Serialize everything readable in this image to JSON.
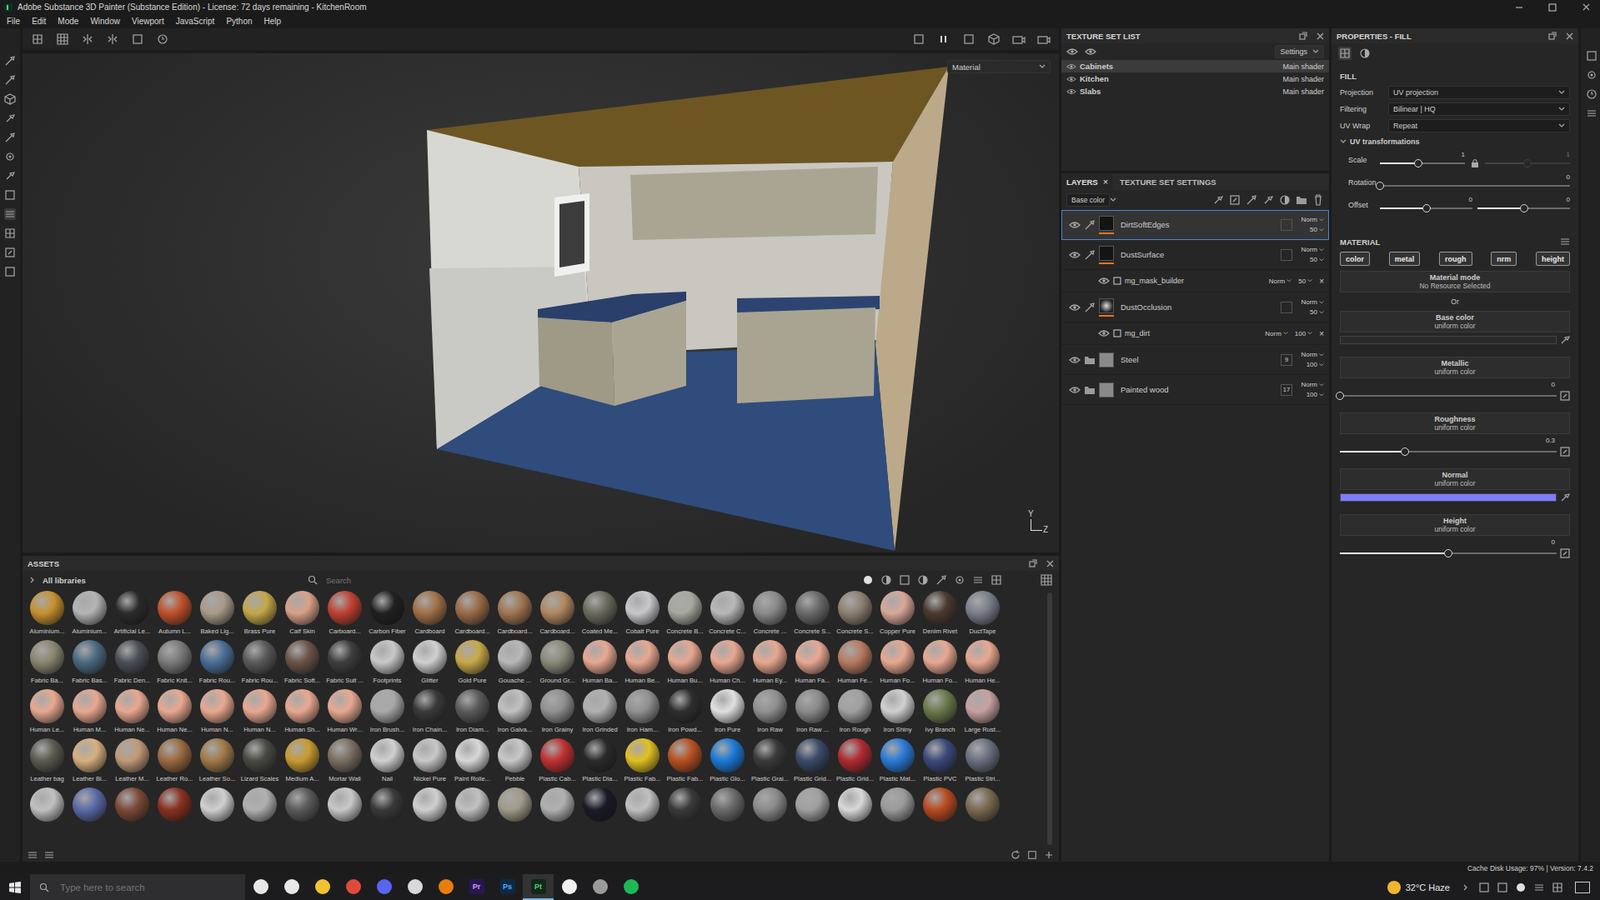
{
  "window": {
    "title": "Adobe Substance 3D Painter (Substance Edition) - License: 72 days remaining - KitchenRoom"
  },
  "menu": [
    "File",
    "Edit",
    "Mode",
    "Window",
    "Viewport",
    "JavaScript",
    "Python",
    "Help"
  ],
  "viewport": {
    "shading": "Material",
    "axes": [
      "Y",
      "Z"
    ]
  },
  "texture_set_list": {
    "title": "TEXTURE SET LIST",
    "settings": "Settings",
    "items": [
      {
        "name": "Cabinets",
        "shader": "Main shader",
        "selected": true,
        "visible": true
      },
      {
        "name": "Kitchen",
        "shader": "Main shader",
        "selected": false,
        "visible": true
      },
      {
        "name": "Slabs",
        "shader": "Main shader",
        "selected": false,
        "visible": true
      }
    ]
  },
  "layers": {
    "tabs": [
      {
        "label": "LAYERS",
        "selected": true,
        "close": "×"
      },
      {
        "label": "TEXTURE SET SETTINGS",
        "selected": false
      }
    ],
    "channel": "Base color",
    "items": [
      {
        "kind": "fill",
        "name": "DirtSoftEdges",
        "blend": "Norm",
        "opacity": "50",
        "selected": true,
        "visible": true
      },
      {
        "kind": "fill",
        "name": "DustSurface",
        "blend": "Norm",
        "opacity": "50",
        "selected": false,
        "visible": true
      },
      {
        "kind": "mask",
        "name": "mg_mask_builder",
        "blend": "Norm",
        "opacity": "50",
        "remove": "×",
        "selected": false,
        "visible": true
      },
      {
        "kind": "fill",
        "name": "DustOcclusion",
        "blend": "Norm",
        "opacity": "50",
        "selected": false,
        "visible": true
      },
      {
        "kind": "mask",
        "name": "mg_dirt",
        "blend": "Norm",
        "opacity": "100",
        "remove": "×",
        "selected": false,
        "visible": true
      },
      {
        "kind": "folder",
        "name": "Steel",
        "count": "9",
        "blend": "Norm",
        "opacity": "100",
        "selected": false,
        "visible": true
      },
      {
        "kind": "folder",
        "name": "Painted wood",
        "count": "17",
        "blend": "Norm",
        "opacity": "100",
        "selected": false,
        "visible": true
      }
    ]
  },
  "properties": {
    "title": "PROPERTIES - FILL",
    "section": "FILL",
    "fields": [
      {
        "label": "Projection",
        "value": "UV projection"
      },
      {
        "label": "Filtering",
        "value": "Bilinear | HQ"
      },
      {
        "label": "UV Wrap",
        "value": "Repeat"
      }
    ],
    "uv": {
      "title": "UV transformations",
      "expanded": true,
      "rows": [
        {
          "label": "Scale",
          "locked": true,
          "sliders": [
            {
              "value": "1",
              "level": 0.45,
              "disabled": false
            },
            {
              "value": "1",
              "level": 0.5,
              "disabled": true
            }
          ]
        },
        {
          "label": "Rotation",
          "sliders": [
            {
              "value": "0",
              "level": 0,
              "disabled": false
            }
          ]
        },
        {
          "label": "Offset",
          "sliders": [
            {
              "value": "0",
              "level": 0.5,
              "disabled": false
            },
            {
              "value": "0",
              "level": 0.5,
              "disabled": false
            }
          ]
        }
      ]
    },
    "material": {
      "title": "MATERIAL",
      "channels": [
        {
          "label": "color",
          "on": true
        },
        {
          "label": "metal",
          "on": true
        },
        {
          "label": "rough",
          "on": true
        },
        {
          "label": "nrm",
          "on": true
        },
        {
          "label": "height",
          "on": true
        }
      ],
      "mode_label": "Material mode",
      "mode_value": "No Resource Selected",
      "or": "Or",
      "params": [
        {
          "kind": "color",
          "label": "Base color",
          "sub": "uniform color",
          "color": "#2a2a2a"
        },
        {
          "kind": "slider",
          "label": "Metallic",
          "sub": "uniform color",
          "value": "0",
          "level": 0
        },
        {
          "kind": "slider",
          "label": "Roughness",
          "sub": "uniform color",
          "value": "0.3",
          "level": 0.3
        },
        {
          "kind": "color",
          "label": "Normal",
          "sub": "uniform color",
          "color": "#7f7bff"
        },
        {
          "kind": "slider",
          "label": "Height",
          "sub": "uniform color",
          "value": "0",
          "level": 0.5
        }
      ]
    }
  },
  "assets": {
    "title": "ASSETS",
    "library": "All libraries",
    "search_placeholder": "Search",
    "rows": [
      [
        {
          "name": "Aluminium...",
          "color": "#c8902e"
        },
        {
          "name": "Aluminium...",
          "color": "#b4b4b4"
        },
        {
          "name": "Artificial Le...",
          "color": "#2a2a2a"
        },
        {
          "name": "Autumn L...",
          "color": "#c0502a"
        },
        {
          "name": "Baked Lig...",
          "color": "#a89a88"
        },
        {
          "name": "Brass Pure",
          "color": "#c4a84a"
        },
        {
          "name": "Calf Skin",
          "color": "#d9a088"
        },
        {
          "name": "Carboard...",
          "color": "#c04030"
        },
        {
          "name": "Carbon Fiber",
          "color": "#202020"
        },
        {
          "name": "Cardboard",
          "color": "#a07048"
        },
        {
          "name": "Cardboard...",
          "color": "#9a6a48"
        },
        {
          "name": "Cardboard...",
          "color": "#a07550"
        },
        {
          "name": "Cardboard...",
          "color": "#b08860"
        },
        {
          "name": "Coated Me...",
          "color": "#6a6a5e"
        },
        {
          "name": "Cobalt Pure",
          "color": "#c8c8cc"
        },
        {
          "name": "Concrete B...",
          "color": "#a8a8a0"
        },
        {
          "name": "Concrete C...",
          "color": "#b8b8b8"
        },
        {
          "name": "Concrete ...",
          "color": "#8a8a8a"
        },
        {
          "name": "Concrete S...",
          "color": "#6a6a6a"
        },
        {
          "name": "Concrete S...",
          "color": "#8c8070"
        },
        {
          "name": "Copper Pure",
          "color": "#d8a898"
        },
        {
          "name": "Denim Rivet",
          "color": "#4a3a30"
        },
        {
          "name": "DuctTape",
          "color": "#7a7e8a"
        }
      ],
      [
        {
          "name": "Fabric Ba...",
          "color": "#8a8670"
        },
        {
          "name": "Fabric Bas...",
          "color": "#4a6a80"
        },
        {
          "name": "Fabric Den...",
          "color": "#4a4e56"
        },
        {
          "name": "Fabric Knit...",
          "color": "#7a7a7a"
        },
        {
          "name": "Fabric Rou...",
          "color": "#4a6e96"
        },
        {
          "name": "Fabric Rou...",
          "color": "#5a5a5a"
        },
        {
          "name": "Fabric Soft...",
          "color": "#6a5448"
        },
        {
          "name": "Fabric Suit ...",
          "color": "#3e3e3e"
        },
        {
          "name": "Footprints",
          "color": "#c8c8c8"
        },
        {
          "name": "Glitter",
          "color": "#d0d0d0"
        },
        {
          "name": "Gold Pure",
          "color": "#c8a848"
        },
        {
          "name": "Gouache ...",
          "color": "#b8b8b8"
        },
        {
          "name": "Ground Gr...",
          "color": "#8a8a7a"
        },
        {
          "name": "Human Ba...",
          "color": "#e8a890"
        },
        {
          "name": "Human Be...",
          "color": "#e8a890"
        },
        {
          "name": "Human Bu...",
          "color": "#e8a890"
        },
        {
          "name": "Human Ch...",
          "color": "#e8a890"
        },
        {
          "name": "Human Ey...",
          "color": "#e8a890"
        },
        {
          "name": "Human Fa...",
          "color": "#e8a890"
        },
        {
          "name": "Human Fe...",
          "color": "#b87a60"
        },
        {
          "name": "Human Fo...",
          "color": "#e8a890"
        },
        {
          "name": "Human Fo...",
          "color": "#e8a890"
        },
        {
          "name": "Human He...",
          "color": "#e8a890"
        }
      ],
      [
        {
          "name": "Human Le...",
          "color": "#e8a890"
        },
        {
          "name": "Human M...",
          "color": "#e8a890"
        },
        {
          "name": "Human Ne...",
          "color": "#e8a890"
        },
        {
          "name": "Human Ne...",
          "color": "#e8a890"
        },
        {
          "name": "Human N...",
          "color": "#e8a890"
        },
        {
          "name": "Human N...",
          "color": "#e8a890"
        },
        {
          "name": "Human Sh...",
          "color": "#e8a890"
        },
        {
          "name": "Human Wr...",
          "color": "#e8a890"
        },
        {
          "name": "Iron Brush...",
          "color": "#a8a8a8"
        },
        {
          "name": "Iron Chain...",
          "color": "#3a3a3a"
        },
        {
          "name": "Iron Diam...",
          "color": "#5a5a5a"
        },
        {
          "name": "Iron Galva...",
          "color": "#c0c0c0"
        },
        {
          "name": "Iron Grainy",
          "color": "#909090"
        },
        {
          "name": "Iron Grinded",
          "color": "#b0b0b0"
        },
        {
          "name": "Iron Ham...",
          "color": "#909090"
        },
        {
          "name": "Iron Powd...",
          "color": "#2e2e2e"
        },
        {
          "name": "Iron Pure",
          "color": "#e0e0e0"
        },
        {
          "name": "Iron Raw",
          "color": "#909090"
        },
        {
          "name": "Iron Raw ...",
          "color": "#8a8a8a"
        },
        {
          "name": "Iron Rough",
          "color": "#a0a0a0"
        },
        {
          "name": "Iron Shiny",
          "color": "#d0d0d0"
        },
        {
          "name": "Ivy Branch",
          "color": "#6a7a4a"
        },
        {
          "name": "Large Rust...",
          "color": "#c8a0a0"
        }
      ],
      [
        {
          "name": "Leather bag",
          "color": "#5a5a50"
        },
        {
          "name": "Leather Bi...",
          "color": "#d8b080"
        },
        {
          "name": "Leather M...",
          "color": "#c09a78"
        },
        {
          "name": "Leather Ro...",
          "color": "#9a6a40"
        },
        {
          "name": "Leather So...",
          "color": "#a07a48"
        },
        {
          "name": "Lizard Scales",
          "color": "#4a4a42"
        },
        {
          "name": "Medium A...",
          "color": "#c89a30"
        },
        {
          "name": "Mortar Wall",
          "color": "#7a6e60"
        },
        {
          "name": "Nail",
          "color": "#d0d0d0"
        },
        {
          "name": "Nickel Pure",
          "color": "#c8c8c8"
        },
        {
          "name": "Paint Rolle...",
          "color": "#d8d8d8"
        },
        {
          "name": "Pebble",
          "color": "#c8c8c8"
        },
        {
          "name": "Plastic Cab...",
          "color": "#c03030"
        },
        {
          "name": "Plastic Dia...",
          "color": "#2a2a2a"
        },
        {
          "name": "Plastic Fab...",
          "color": "#e0c020"
        },
        {
          "name": "Plastic Fab...",
          "color": "#b85020"
        },
        {
          "name": "Plastic Glo...",
          "color": "#1a7ad8"
        },
        {
          "name": "Plastic Grai...",
          "color": "#3a3a3a"
        },
        {
          "name": "Plastic Grid...",
          "color": "#3a4a6a"
        },
        {
          "name": "Plastic Grid...",
          "color": "#b02a30"
        },
        {
          "name": "Plastic Mat...",
          "color": "#2a7ad8"
        },
        {
          "name": "Plastic PVC",
          "color": "#3a4a7a"
        },
        {
          "name": "Plastic Stri...",
          "color": "#6a7080"
        }
      ],
      [
        {
          "color": "#c0c0c0"
        },
        {
          "color": "#5a6aa8"
        },
        {
          "color": "#7a4a38"
        },
        {
          "color": "#8a3020"
        },
        {
          "color": "#d0d0d0"
        },
        {
          "color": "#b0b0b0"
        },
        {
          "color": "#5a5a5a"
        },
        {
          "color": "#c8c8c8"
        },
        {
          "color": "#3a3a3a"
        },
        {
          "color": "#d0d0d0"
        },
        {
          "color": "#c0c0c0"
        },
        {
          "color": "#a09a88"
        },
        {
          "color": "#b0b0b0"
        },
        {
          "color": "#1a1a28"
        },
        {
          "color": "#c0c0c0"
        },
        {
          "color": "#3a3a3a"
        },
        {
          "color": "#6a6a6a"
        },
        {
          "color": "#8a8a8a"
        },
        {
          "color": "#a0a0a0"
        },
        {
          "color": "#d8d8d8"
        },
        {
          "color": "#9a9a9a"
        },
        {
          "color": "#b84a20"
        },
        {
          "color": "#7a6a50"
        }
      ]
    ]
  },
  "status_bar": "Cache Disk Usage:  97% | Version: 7.4.2",
  "taskbar": {
    "search_placeholder": "Type here to search",
    "weather": "32°C  Haze",
    "apps": [
      {
        "label": "",
        "color": "#e8e8e8",
        "active": false
      },
      {
        "label": "",
        "color": "#e8e8e8",
        "active": false
      },
      {
        "label": "",
        "color": "#f2c230",
        "active": false
      },
      {
        "label": "",
        "color": "#de4a3a",
        "active": false
      },
      {
        "label": "",
        "color": "#5865f2",
        "active": false
      },
      {
        "label": "",
        "color": "#d8d8d8",
        "active": false
      },
      {
        "label": "",
        "color": "#e87d0d",
        "active": false
      },
      {
        "label": "Pr",
        "color": "#2a1650",
        "active": false
      },
      {
        "label": "Ps",
        "color": "#0d2a45",
        "active": false
      },
      {
        "label": "Pt",
        "color": "#102818",
        "active": true
      },
      {
        "label": "",
        "color": "#f0f0f0",
        "active": false
      },
      {
        "label": "",
        "color": "#9a9a9a",
        "active": false
      },
      {
        "label": "",
        "color": "#1db954",
        "active": false
      }
    ]
  }
}
